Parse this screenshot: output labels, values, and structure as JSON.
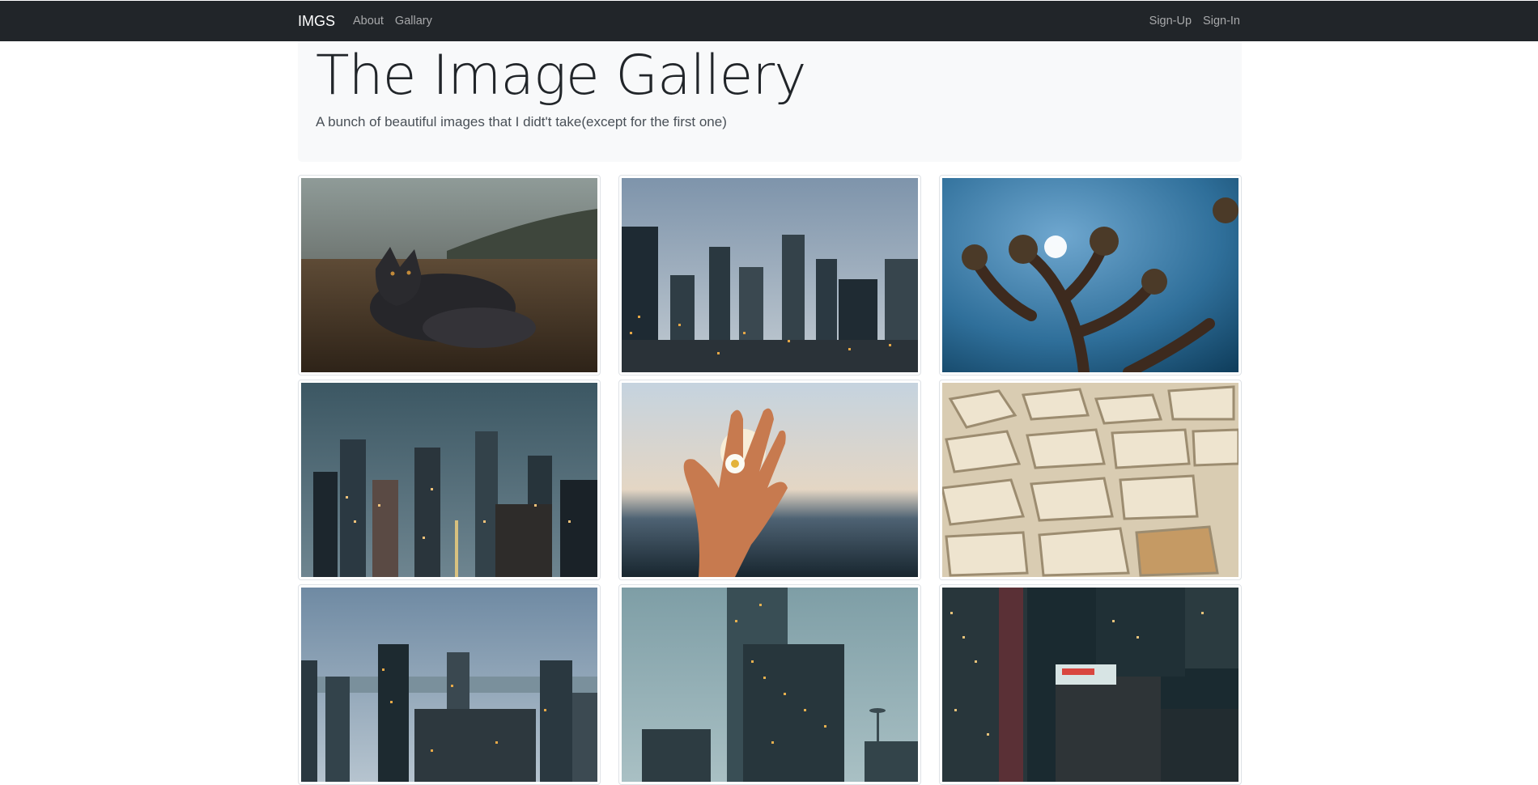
{
  "nav": {
    "brand": "IMGS",
    "links": [
      "About",
      "Gallary"
    ],
    "auth": [
      "Sign-Up",
      "Sign-In"
    ]
  },
  "jumbotron": {
    "title": "The Image Gallery",
    "lead": "A bunch of beautiful images that I didt't take(except for the first one)"
  },
  "gallery": {
    "images": [
      {
        "subject": "arctic-fox"
      },
      {
        "subject": "city-skyline-overcast"
      },
      {
        "subject": "joshua-tree-sun"
      },
      {
        "subject": "city-night-fog"
      },
      {
        "subject": "hand-holding-daisy"
      },
      {
        "subject": "salt-terraces"
      },
      {
        "subject": "city-waterfront"
      },
      {
        "subject": "skyscrapers-space-needle"
      },
      {
        "subject": "city-night-neon"
      }
    ]
  },
  "colors": {
    "navbar": "#212529",
    "jumbotron": "#f8f9fa",
    "nav_link": "#9a9da0"
  }
}
